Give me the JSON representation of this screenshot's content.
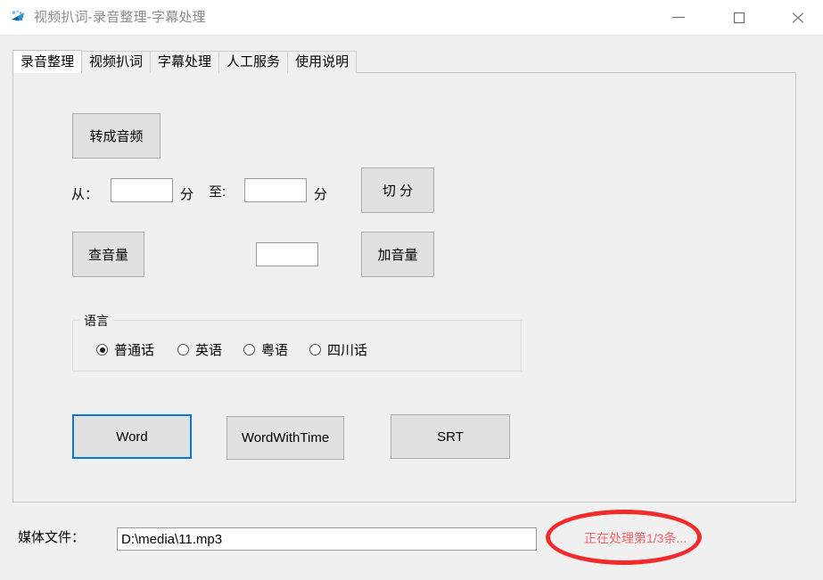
{
  "window": {
    "title": "视频扒词-录音整理-字幕处理",
    "icon": "video-app-icon",
    "controls": [
      {
        "name": "minimize-button",
        "icon": "minimize-icon"
      },
      {
        "name": "maximize-button",
        "icon": "maximize-icon"
      },
      {
        "name": "close-button",
        "icon": "close-icon"
      }
    ]
  },
  "tabs": [
    {
      "label": "录音整理",
      "active": true
    },
    {
      "label": "视频扒词",
      "active": false
    },
    {
      "label": "字幕处理",
      "active": false
    },
    {
      "label": "人工服务",
      "active": false
    },
    {
      "label": "使用说明",
      "active": false
    }
  ],
  "panel": {
    "convert_button": "转成音频",
    "from_label": "从：",
    "from_value": "",
    "from_unit": "分",
    "to_label": "至:",
    "to_value": "",
    "to_unit": "分",
    "split_button": "切 分",
    "check_volume_button": "查音量",
    "volume_value": "",
    "add_volume_button": "加音量",
    "language_group": {
      "title": "语言",
      "options": [
        {
          "label": "普通话",
          "checked": true
        },
        {
          "label": "英语",
          "checked": false
        },
        {
          "label": "粤语",
          "checked": false
        },
        {
          "label": "四川话",
          "checked": false
        }
      ]
    },
    "export_buttons": [
      {
        "label": "Word",
        "focused": true
      },
      {
        "label": "WordWithTime",
        "focused": false
      },
      {
        "label": "SRT",
        "focused": false
      }
    ]
  },
  "bottom": {
    "media_label": "媒体文件：",
    "media_path": "D:\\media\\11.mp3",
    "media_placeholder": "",
    "status": "正在处理第1/3条...",
    "status_color": "#f4646b",
    "annotation": "red-ellipse-highlight"
  }
}
